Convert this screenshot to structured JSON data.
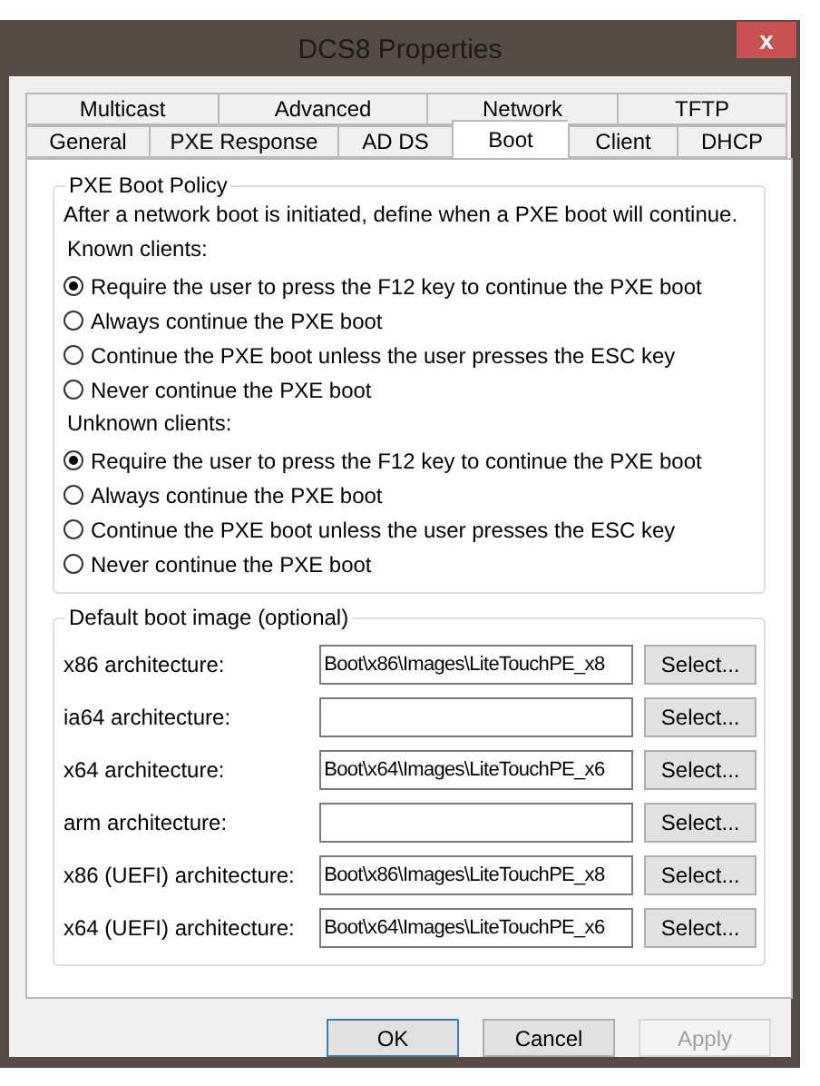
{
  "window": {
    "title": "DCS8 Properties",
    "close": "x"
  },
  "tabs_back_row": [
    {
      "label": "Multicast",
      "selected": false
    },
    {
      "label": "Advanced",
      "selected": false
    },
    {
      "label": "Network",
      "selected": false
    },
    {
      "label": "TFTP",
      "selected": false
    }
  ],
  "tabs_front_row": [
    {
      "label": "General",
      "selected": false
    },
    {
      "label": "PXE Response",
      "selected": false
    },
    {
      "label": "AD DS",
      "selected": false
    },
    {
      "label": "Boot",
      "selected": true
    },
    {
      "label": "Client",
      "selected": false
    },
    {
      "label": "DHCP",
      "selected": false
    }
  ],
  "pxe_boot_policy": {
    "title": "PXE Boot Policy",
    "description": "After a network boot is initiated, define when a PXE boot will continue.",
    "groups": [
      {
        "label": "Known clients:",
        "options": [
          {
            "label": "Require the user to press the F12 key to continue the PXE boot",
            "selected": true
          },
          {
            "label": "Always continue the PXE boot",
            "selected": false
          },
          {
            "label": "Continue the PXE boot unless the user presses the ESC key",
            "selected": false
          },
          {
            "label": "Never continue the PXE boot",
            "selected": false
          }
        ]
      },
      {
        "label": "Unknown clients:",
        "options": [
          {
            "label": "Require the user to press the F12 key to continue the PXE boot",
            "selected": true
          },
          {
            "label": "Always continue the PXE boot",
            "selected": false
          },
          {
            "label": "Continue the PXE boot unless the user presses the ESC key",
            "selected": false
          },
          {
            "label": "Never continue the PXE boot",
            "selected": false
          }
        ]
      }
    ]
  },
  "default_boot_image": {
    "title": "Default boot image (optional)",
    "rows": [
      {
        "label": "x86 architecture:",
        "value": "Boot\\x86\\Images\\LiteTouchPE_x8",
        "button": "Select..."
      },
      {
        "label": "ia64 architecture:",
        "value": "",
        "button": "Select..."
      },
      {
        "label": "x64 architecture:",
        "value": "Boot\\x64\\Images\\LiteTouchPE_x6",
        "button": "Select..."
      },
      {
        "label": "arm architecture:",
        "value": "",
        "button": "Select..."
      },
      {
        "label": "x86 (UEFI) architecture:",
        "value": "Boot\\x86\\Images\\LiteTouchPE_x8",
        "button": "Select..."
      },
      {
        "label": "x64 (UEFI) architecture:",
        "value": "Boot\\x64\\Images\\LiteTouchPE_x6",
        "button": "Select..."
      }
    ]
  },
  "buttons": [
    {
      "label": "OK",
      "kind": "default",
      "disabled": false
    },
    {
      "label": "Cancel",
      "kind": "normal",
      "disabled": false
    },
    {
      "label": "Apply",
      "kind": "normal",
      "disabled": true
    }
  ]
}
